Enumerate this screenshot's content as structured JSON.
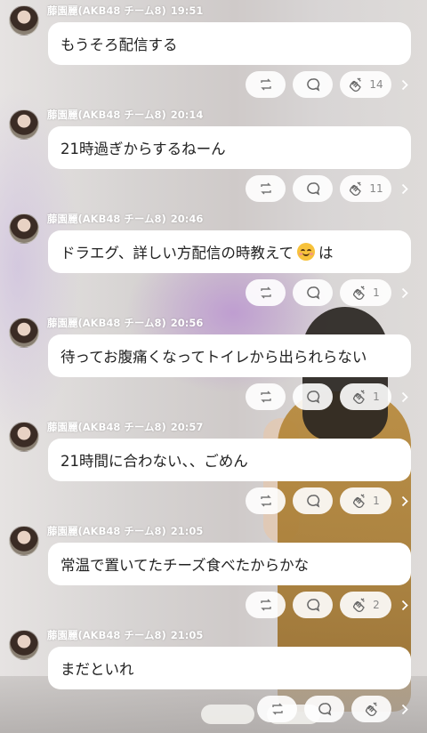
{
  "messages": [
    {
      "sender": "藤園麗(AKB48 チーム8)",
      "time": "19:51",
      "text": "もうそろ配信する",
      "likes": "14"
    },
    {
      "sender": "藤園麗(AKB48 チーム8)",
      "time": "20:14",
      "text": "21時過ぎからするねーん",
      "likes": "11"
    },
    {
      "sender": "藤園麗(AKB48 チーム8)",
      "time": "20:46",
      "text_before": "ドラエグ、詳しい方配信の時教えて",
      "emoji": "relieved-face-emoji",
      "text_after": "は",
      "likes": "1"
    },
    {
      "sender": "藤園麗(AKB48 チーム8)",
      "time": "20:56",
      "text": "待ってお腹痛くなってトイレから出られらない",
      "likes": "1"
    },
    {
      "sender": "藤園麗(AKB48 チーム8)",
      "time": "20:57",
      "text": "21時間に合わない、、ごめん",
      "likes": "1"
    },
    {
      "sender": "藤園麗(AKB48 チーム8)",
      "time": "21:05",
      "text": "常温で置いてたチーズ食べたからかな",
      "likes": "2"
    },
    {
      "sender": "藤園麗(AKB48 チーム8)",
      "time": "21:05",
      "text": "まだといれ",
      "likes": ""
    }
  ],
  "icons": {
    "repost": "repost-icon",
    "comment": "comment-icon",
    "like": "clap-hand-icon",
    "more": "chevron-right-icon"
  }
}
